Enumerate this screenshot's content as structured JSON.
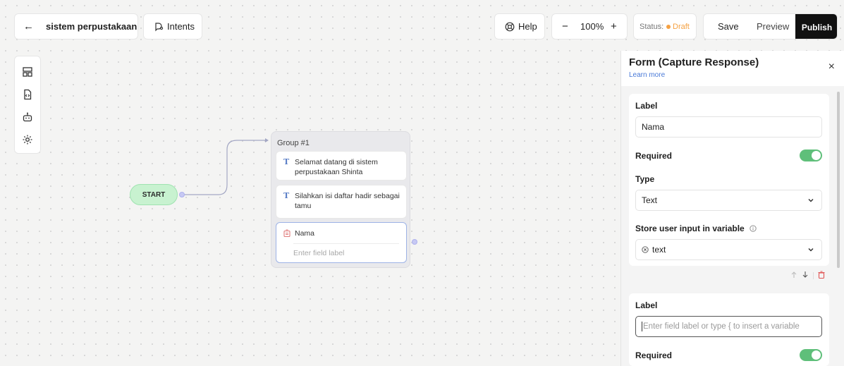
{
  "header": {
    "back_label": "←",
    "project_name": "sistem perpustakaan",
    "intents_label": "Intents",
    "help_label": "Help",
    "zoom_minus": "−",
    "zoom_level": "100%",
    "zoom_plus": "+",
    "status_label": "Status:",
    "status_value": "Draft",
    "save_label": "Save",
    "preview_label": "Preview",
    "publish_label": "Publish"
  },
  "colors": {
    "draft": "#f5a142",
    "publish_bg": "#111111",
    "toggle_on": "#5fbf7a",
    "start_bg": "#c8f2d0",
    "link": "#4a7ad8"
  },
  "left_toolbar": [
    {
      "icon": "layout-icon"
    },
    {
      "icon": "code-file-icon"
    },
    {
      "icon": "bot-icon"
    },
    {
      "icon": "settings-icon"
    }
  ],
  "canvas": {
    "start_label": "START",
    "group_title": "Group #1",
    "blocks": [
      {
        "type": "text",
        "text": "Selamat datang di sistem perpustakaan Shinta"
      },
      {
        "type": "text",
        "text": "Silahkan isi daftar hadir sebagai tamu"
      },
      {
        "type": "form",
        "label": "Nama",
        "placeholder": "Enter field label"
      }
    ]
  },
  "panel": {
    "title": "Form (Capture Response)",
    "learn_more": "Learn more",
    "close": "×",
    "fields": [
      {
        "label_heading": "Label",
        "label_value": "Nama",
        "required_label": "Required",
        "type_heading": "Type",
        "type_value": "Text",
        "store_heading": "Store user input in variable",
        "variable_value": "text"
      },
      {
        "label_heading": "Label",
        "label_placeholder": "Enter field label or type { to insert a variable",
        "required_label": "Required"
      }
    ]
  }
}
